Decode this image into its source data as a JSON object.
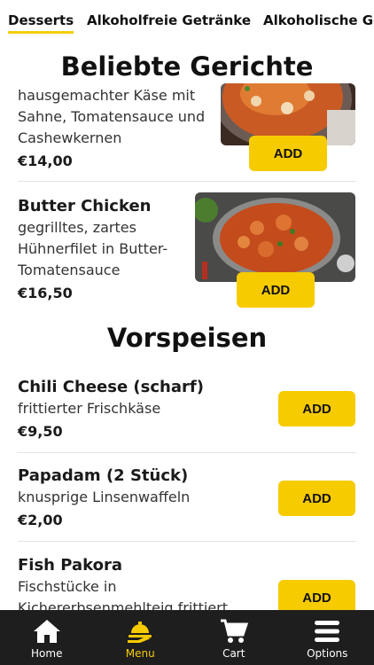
{
  "tabs": [
    {
      "label": "Desserts",
      "active": true
    },
    {
      "label": "Alkoholfreie Getränke",
      "active": false
    },
    {
      "label": "Alkoholische Getränke",
      "active": false
    }
  ],
  "sticky_section": "Beliebte Gerichte",
  "popular": [
    {
      "name": "",
      "desc_lines": [
        "hausgemachter Käse mit",
        "Sahne, Tomatensauce und",
        "Cashewkernen"
      ],
      "price": "€14,00",
      "add": "ADD"
    },
    {
      "name": "Butter Chicken",
      "desc_lines": [
        "gegrilltes, zartes",
        "Hühnerfilet in Butter-",
        "Tomatensauce"
      ],
      "price": "€16,50",
      "add": "ADD"
    }
  ],
  "starters_title": "Vorspeisen",
  "starters": [
    {
      "name": "Chili Cheese (scharf)",
      "desc": "frittierter Frischkäse",
      "price": "€9,50",
      "add": "ADD"
    },
    {
      "name": "Papadam (2 Stück)",
      "desc": "knusprige Linsenwaffeln",
      "price": "€2,00",
      "add": "ADD"
    },
    {
      "name": "Fish Pakora",
      "desc_lines": [
        "Fischstücke in",
        "Kichererbsenmehlteig frittiert"
      ],
      "add": "ADD"
    }
  ],
  "bottom_nav": [
    {
      "label": "Home",
      "icon": "home-icon",
      "active": false
    },
    {
      "label": "Menu",
      "icon": "menu-dish-icon",
      "active": true
    },
    {
      "label": "Cart",
      "icon": "cart-icon",
      "active": false
    },
    {
      "label": "Options",
      "icon": "options-icon",
      "active": false
    }
  ],
  "colors": {
    "accent": "#f6cb00",
    "nav_bg": "#1e1e1e"
  }
}
